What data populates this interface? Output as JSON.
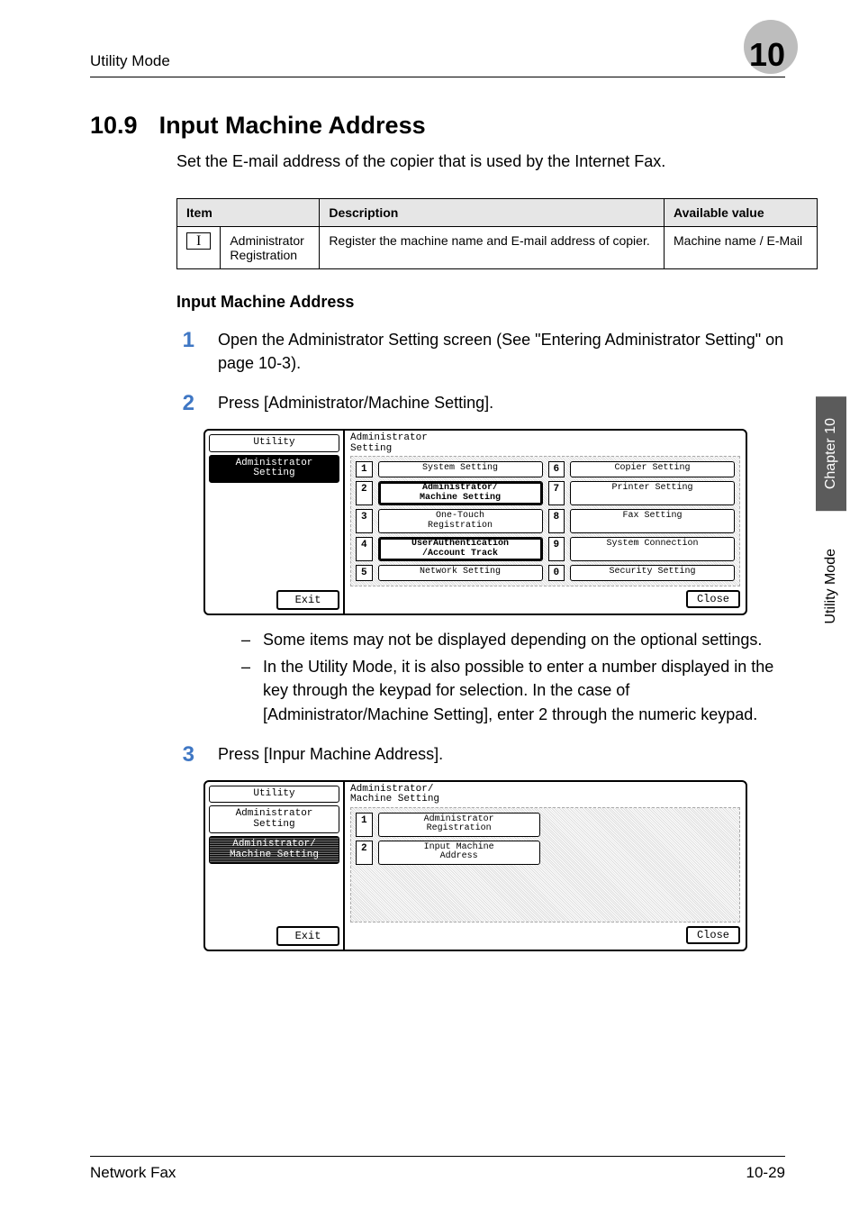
{
  "header": {
    "left": "Utility Mode",
    "chapter_num": "10"
  },
  "section": {
    "num": "10.9",
    "title": "Input Machine Address"
  },
  "intro": "Set the E-mail address of the copier that is used by the Internet Fax.",
  "table": {
    "headers": {
      "item": "Item",
      "desc": "Description",
      "avail": "Available value"
    },
    "row": {
      "box": "I",
      "item": "Administrator Registration",
      "desc": "Register the machine name and E-mail address of copier.",
      "avail": "Machine name / E-Mail"
    }
  },
  "subhead": "Input Machine Address",
  "steps": {
    "s1": {
      "num": "1",
      "text": "Open the Administrator Setting screen (See \"Entering Administrator Setting\" on page 10-3)."
    },
    "s2": {
      "num": "2",
      "text": "Press [Administrator/Machine Setting]."
    },
    "s3": {
      "num": "3",
      "text": "Press [Inpur Machine Address]."
    }
  },
  "bullets": {
    "b1": "Some items may not be displayed depending on the optional settings.",
    "b2": "In the Utility Mode, it is also possible to enter a number displayed in the key through the keypad for selection. In the case of [Administrator/Machine Setting], enter 2 through the numeric keypad."
  },
  "lcd1": {
    "left": {
      "utility": "Utility",
      "admin": "Administrator\nSetting",
      "exit": "Exit"
    },
    "title": "Administrator\nSetting",
    "buttons": {
      "b1": "System Setting",
      "b2": "Administrator/\nMachine Setting",
      "b3": "One-Touch\nRegistration",
      "b4": "UserAuthentication\n/Account Track",
      "b5": "Network Setting",
      "b6": "Copier Setting",
      "b7": "Printer Setting",
      "b8": "Fax Setting",
      "b9": "System Connection",
      "b0": "Security Setting"
    },
    "nums": {
      "n1": "1",
      "n2": "2",
      "n3": "3",
      "n4": "4",
      "n5": "5",
      "n6": "6",
      "n7": "7",
      "n8": "8",
      "n9": "9",
      "n0": "0"
    },
    "close": "Close"
  },
  "lcd2": {
    "left": {
      "utility": "Utility",
      "admin": "Administrator\nSetting",
      "machine": "Administrator/\nMachine Setting",
      "exit": "Exit"
    },
    "title": "Administrator/\nMachine Setting",
    "buttons": {
      "b1": "Administrator\nRegistration",
      "b2": "Input Machine\nAddress"
    },
    "nums": {
      "n1": "1",
      "n2": "2"
    },
    "close": "Close"
  },
  "sidetabs": {
    "dark": "Chapter 10",
    "light": "Utility Mode"
  },
  "footer": {
    "left": "Network Fax",
    "right": "10-29"
  }
}
